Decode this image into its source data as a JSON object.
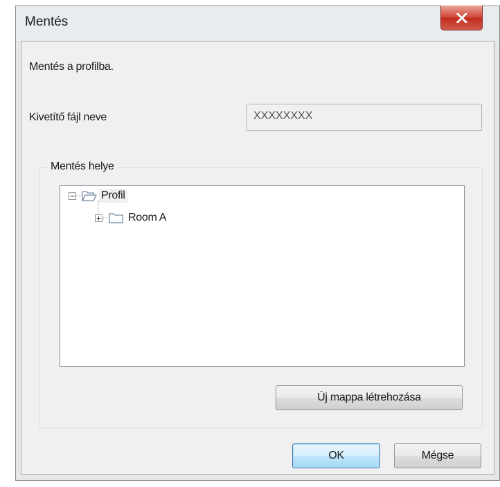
{
  "window": {
    "title": "Mentés"
  },
  "dialog": {
    "instruction": "Mentés a profilba.",
    "filename_label": "Kivetítő fájl neve",
    "filename_value": "XXXXXXXX",
    "location_group_label": "Mentés helye",
    "tree": [
      {
        "label": "Profil",
        "expanded": true,
        "selected": true,
        "icon": "folder-open-icon"
      },
      {
        "label": "Room A",
        "expanded": false,
        "selected": false,
        "icon": "folder-icon"
      }
    ],
    "new_folder_button": "Új mappa létrehozása",
    "ok_button": "OK",
    "cancel_button": "Mégse"
  },
  "colors": {
    "close_button": "#c9392b",
    "default_button_border": "#3c7fb1",
    "client_background": "#f0f0f0"
  }
}
